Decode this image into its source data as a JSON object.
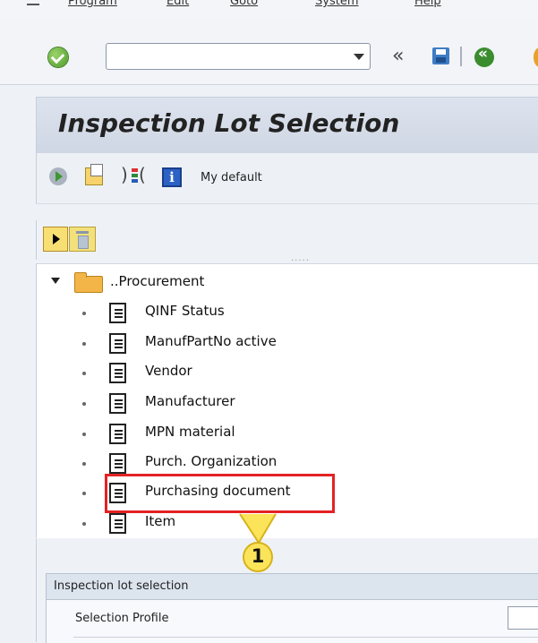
{
  "menu": {
    "items": [
      "Program",
      "Edit",
      "Goto",
      "System",
      "Help"
    ]
  },
  "toolbar": {
    "command_value": "",
    "command_placeholder": "",
    "back_chevron": "«"
  },
  "title": "Inspection Lot Selection",
  "app_toolbar": {
    "info_icon": "i",
    "my_default": "My default"
  },
  "tree": {
    "root": "..Procurement",
    "items": [
      {
        "label": "QINF Status"
      },
      {
        "label": "ManufPartNo active"
      },
      {
        "label": "Vendor"
      },
      {
        "label": "Manufacturer"
      },
      {
        "label": "MPN material"
      },
      {
        "label": "Purch. Organization"
      },
      {
        "label": "Purchasing document"
      },
      {
        "label": "Item"
      }
    ],
    "highlighted_item": "Purchasing document",
    "callout_number": "1"
  },
  "panel": {
    "title": "Inspection lot selection",
    "selection_profile_label": "Selection Profile",
    "selection_profile_value": ""
  }
}
